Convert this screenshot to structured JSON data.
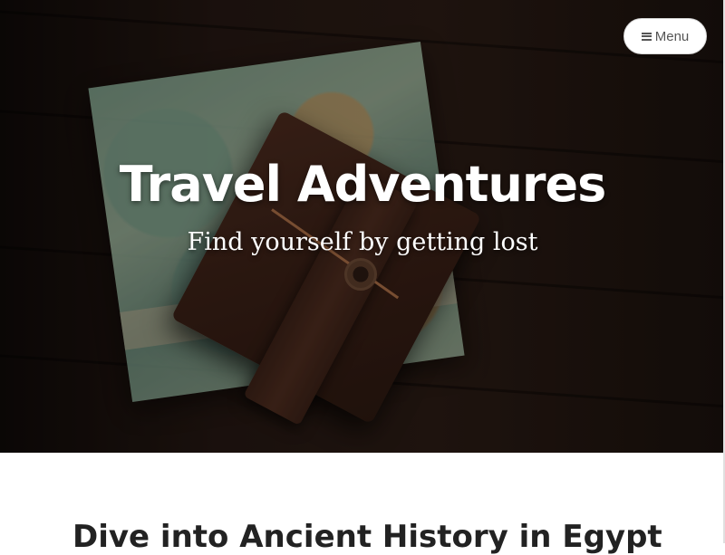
{
  "header": {
    "menu_label": "Menu",
    "menu_icon": "hamburger-icon"
  },
  "hero": {
    "title": "Travel Adventures",
    "tagline": "Find yourself by getting lost"
  },
  "content": {
    "post_title": "Dive into Ancient History in Egypt"
  },
  "colors": {
    "title_text": "#ffffff",
    "post_title_text": "#222222",
    "menu_text": "#555555"
  }
}
